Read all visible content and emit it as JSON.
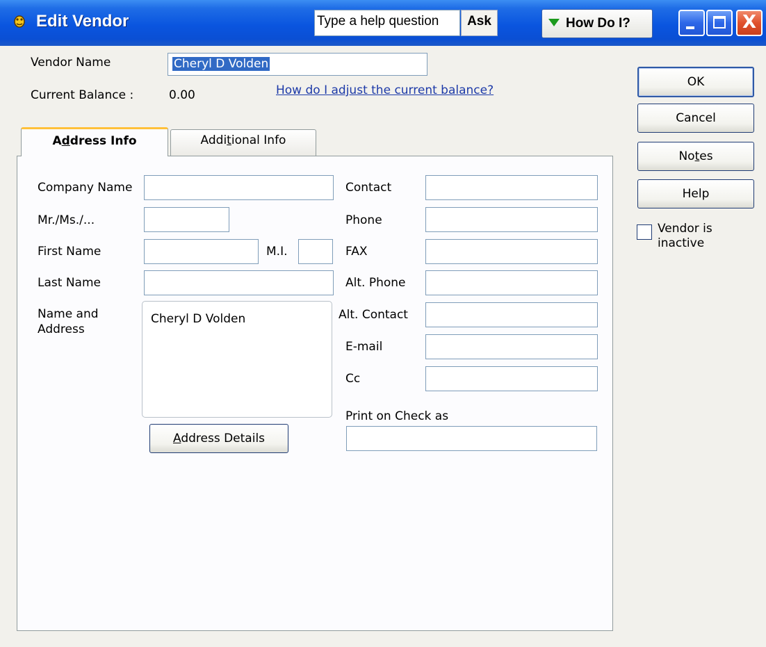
{
  "window": {
    "title": "Edit Vendor",
    "help_placeholder": "Type a help question",
    "ask_label": "Ask",
    "howdo_label": "How Do I?",
    "close_glyph": "X"
  },
  "header": {
    "vendor_name_label": "Vendor Name",
    "vendor_name_value": "Cheryl D Volden",
    "balance_label": "Current Balance :",
    "balance_value": "0.00",
    "adjust_link": "How do I adjust the current balance?"
  },
  "tabs": [
    {
      "label_pre": "A",
      "label_key": "d",
      "label_post": "dress Info",
      "active": true
    },
    {
      "label_pre": "Addi",
      "label_key": "t",
      "label_post": "ional Info",
      "active": false
    }
  ],
  "left_form": {
    "company_name": {
      "label": "Company Name",
      "value": ""
    },
    "salutation": {
      "label": "Mr./Ms./...",
      "value": ""
    },
    "first_name": {
      "label": "First Name",
      "value": ""
    },
    "mi": {
      "label": "M.I.",
      "value": ""
    },
    "last_name": {
      "label": "Last Name",
      "value": ""
    },
    "name_address": {
      "label": "Name and Address",
      "value": "Cheryl D Volden"
    },
    "address_details_pre": "",
    "address_details_key": "A",
    "address_details_post": "ddress Details"
  },
  "right_form": {
    "contact": {
      "label": "Contact",
      "value": ""
    },
    "phone": {
      "label": "Phone",
      "value": ""
    },
    "fax": {
      "label": "FAX",
      "value": ""
    },
    "alt_phone": {
      "label": "Alt. Phone",
      "value": ""
    },
    "alt_contact": {
      "label": "Alt. Contact",
      "value": ""
    },
    "email": {
      "label": "E-mail",
      "value": ""
    },
    "cc": {
      "label": "Cc",
      "value": ""
    },
    "print_on_check": {
      "label": "Print on Check as",
      "value": ""
    }
  },
  "side_buttons": {
    "ok": "OK",
    "cancel": "Cancel",
    "notes_pre": "No",
    "notes_key": "t",
    "notes_post": "es",
    "help": "Help"
  },
  "inactive": {
    "label": "Vendor is inactive",
    "checked": false
  }
}
